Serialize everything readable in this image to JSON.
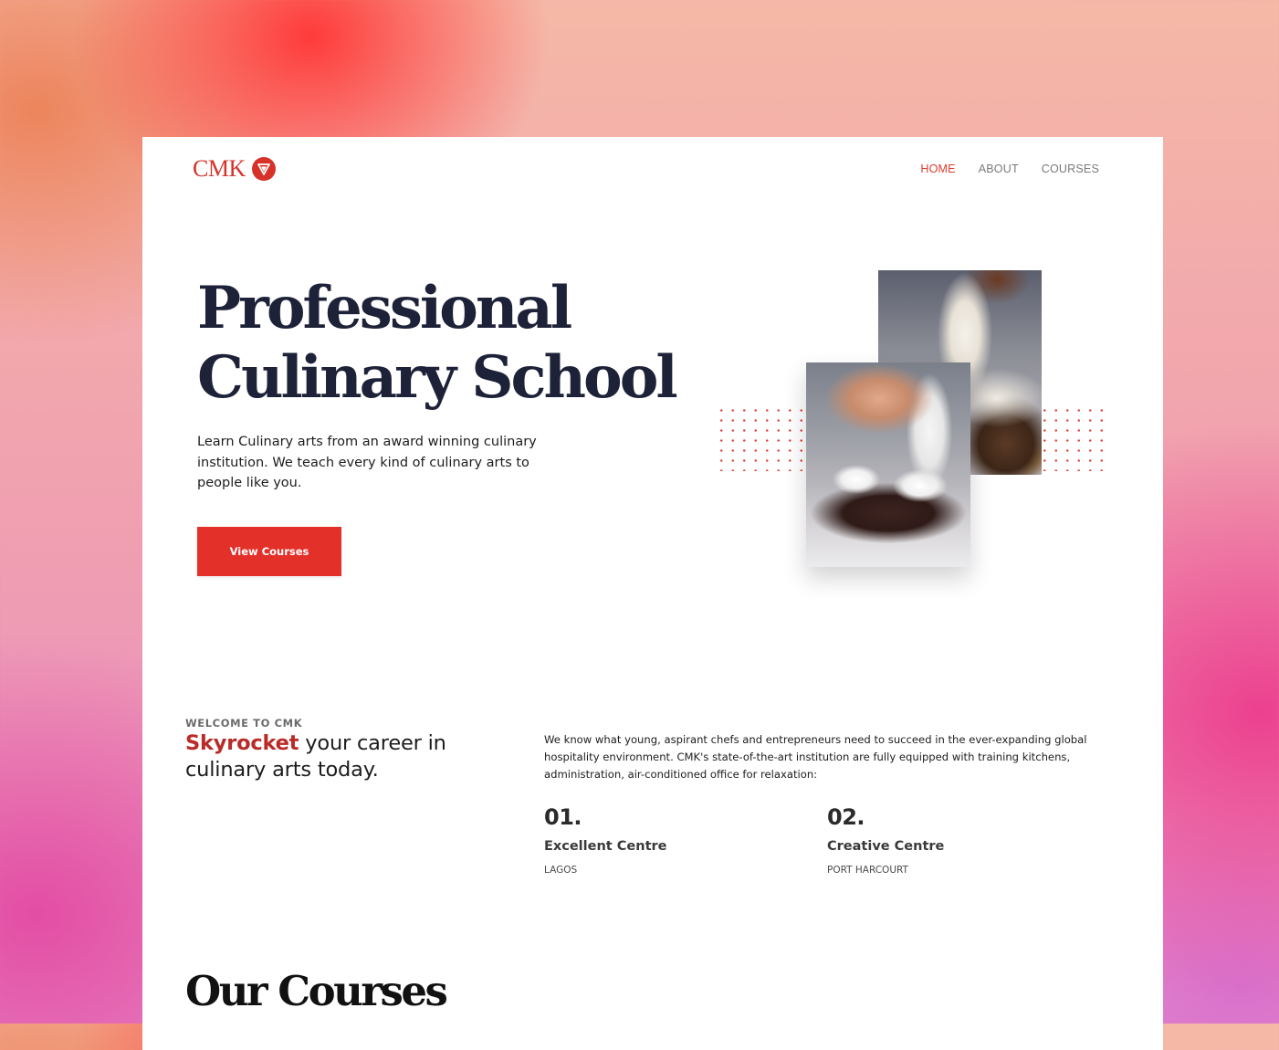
{
  "brand": {
    "name": "CMK",
    "accent_color": "#e3312a",
    "logo_icon": "shield-v-icon"
  },
  "nav": {
    "items": [
      {
        "label": "HOME",
        "active": true
      },
      {
        "label": "ABOUT",
        "active": false
      },
      {
        "label": "COURSES",
        "active": false
      }
    ]
  },
  "hero": {
    "title_line1": "Professional",
    "title_line2": "Culinary School",
    "description": "Learn Culinary arts from an award winning culinary institution. We teach every kind of culinary arts to people like you.",
    "button_label": "View Courses"
  },
  "welcome": {
    "kicker": "WELCOME TO CMK",
    "heading_accent": "Skyrocket",
    "heading_rest": " your career in culinary arts today.",
    "body": "We know what young, aspirant chefs and entrepreneurs need to succeed in the ever-expanding global hospitality environment. CMK's state-of-the-art institution are fully equipped with training kitchens, administration, air-conditioned office for relaxation:",
    "centres": [
      {
        "number": "01.",
        "title": "Excellent Centre",
        "location": "LAGOS"
      },
      {
        "number": "02.",
        "title": "Creative Centre",
        "location": "PORT HARCOURT"
      }
    ]
  },
  "courses": {
    "heading": "Our Courses"
  }
}
